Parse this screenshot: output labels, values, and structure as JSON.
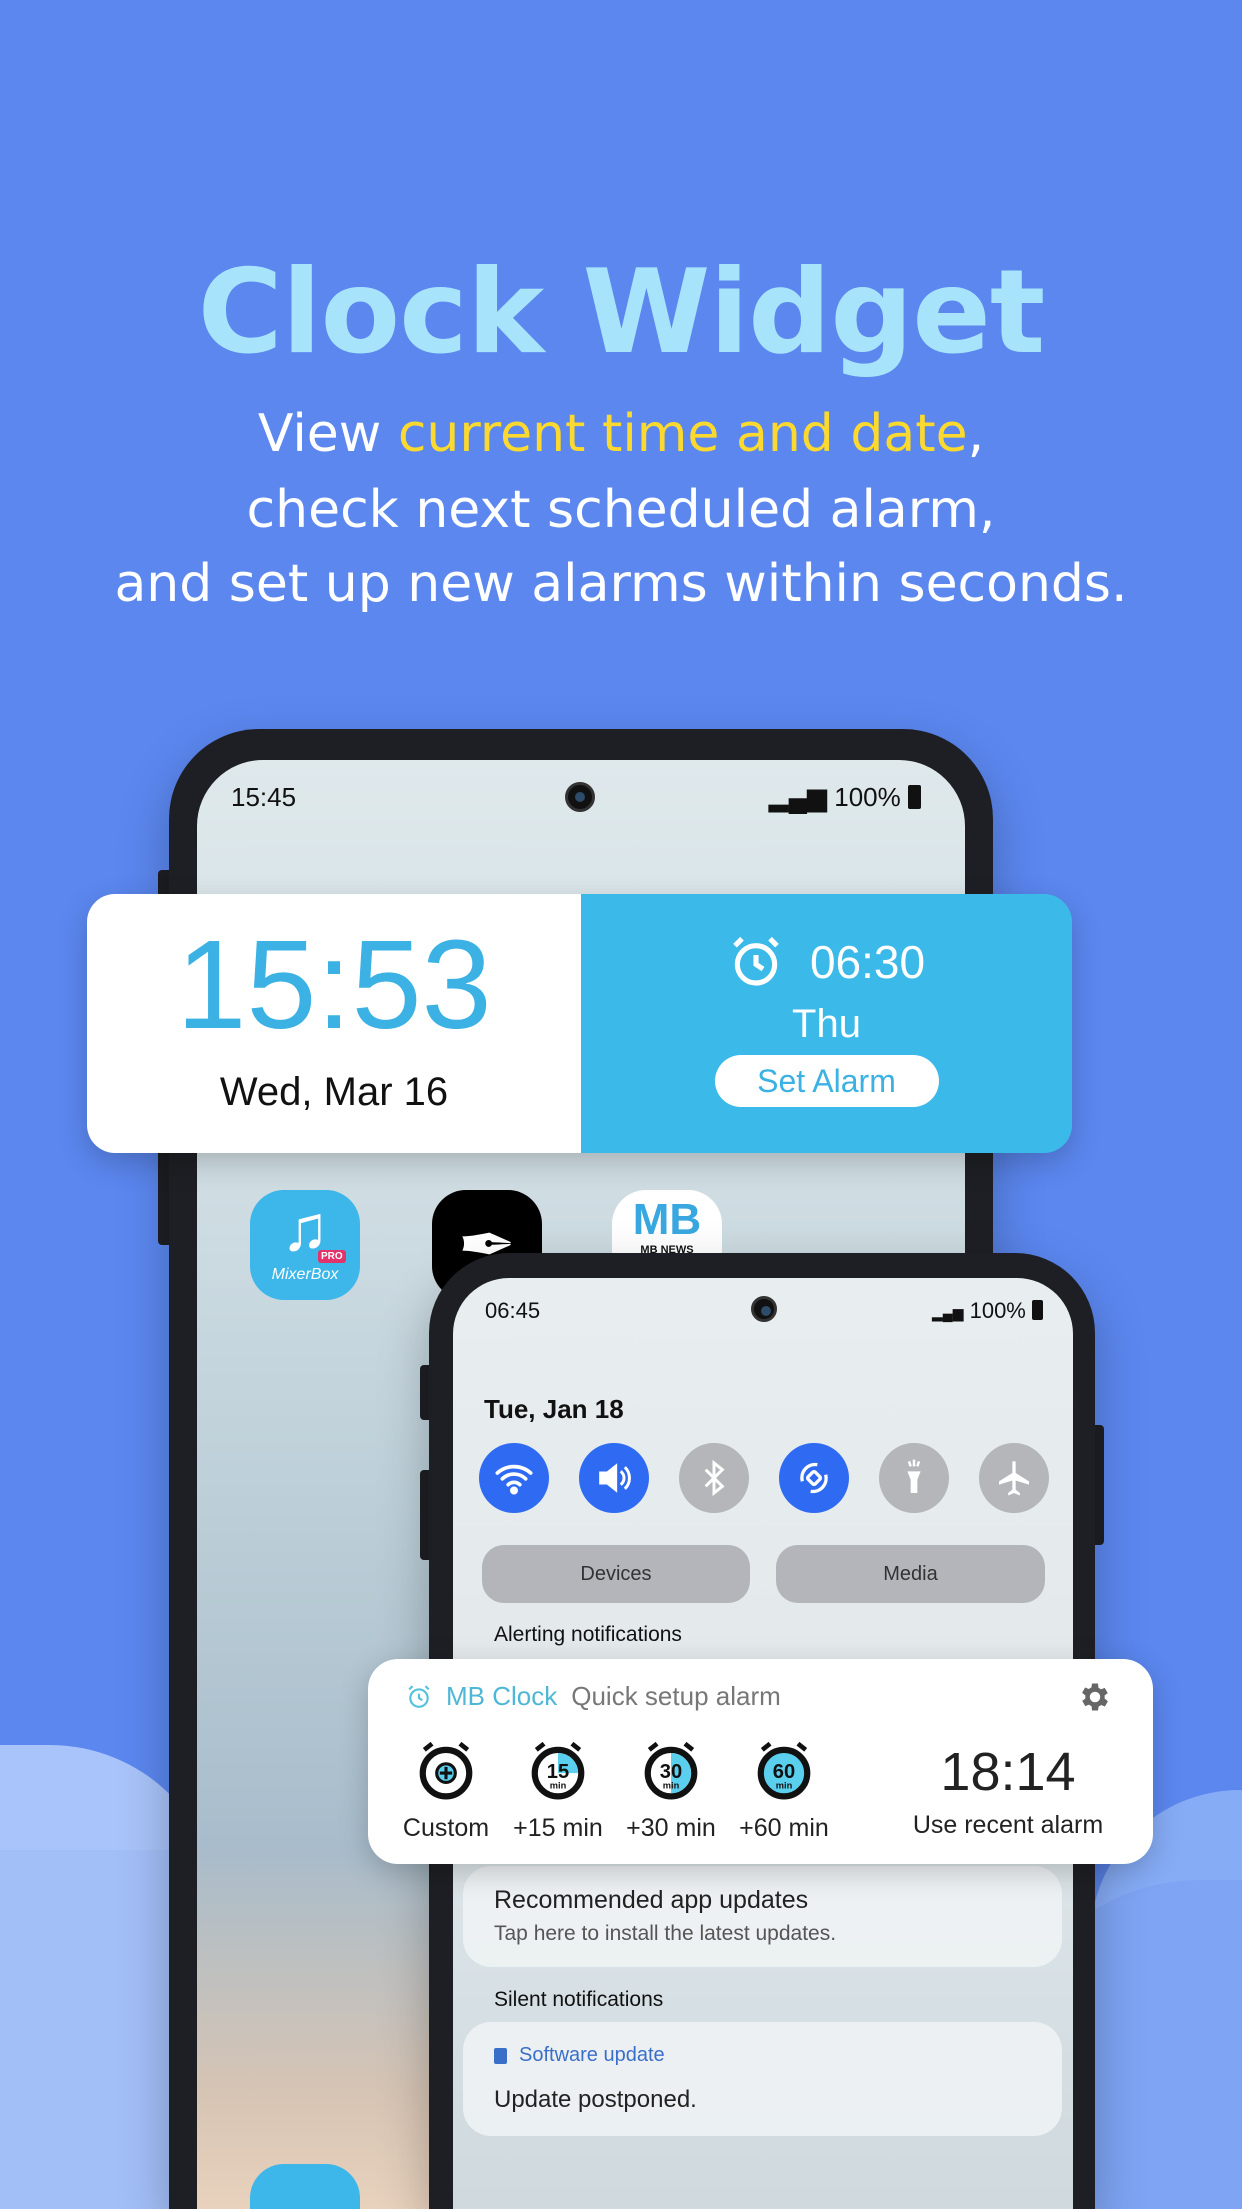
{
  "headline": {
    "title": "Clock Widget",
    "line1_pre": "View ",
    "line1_highlight": "current time and date",
    "line1_post": ",",
    "line2": "check next scheduled alarm,",
    "line3": "and set up new alarms within seconds."
  },
  "colors": {
    "background": "#5b87ef",
    "title": "#a7e4fb",
    "highlight": "#fbd92e",
    "widget_accent": "#3bb9e9",
    "toggle_on": "#2f6af2"
  },
  "phone1": {
    "status_time": "15:45",
    "battery": "100%",
    "widget": {
      "time": "15:53",
      "date": "Wed, Mar 16",
      "alarm_time": "06:30",
      "alarm_day": "Thu",
      "set_alarm_label": "Set Alarm"
    },
    "apps": [
      {
        "name": "MixerBox",
        "badge": "PRO"
      },
      {
        "name": "quill"
      },
      {
        "name": "MB NEWS",
        "text": "MB"
      }
    ]
  },
  "phone2": {
    "status_time": "06:45",
    "battery": "100%",
    "date": "Tue, Jan 18",
    "toggles": [
      {
        "icon": "wifi-icon",
        "on": true
      },
      {
        "icon": "volume-icon",
        "on": true
      },
      {
        "icon": "bluetooth-icon",
        "on": false
      },
      {
        "icon": "auto-rotate-icon",
        "on": true
      },
      {
        "icon": "flashlight-icon",
        "on": false
      },
      {
        "icon": "airplane-icon",
        "on": false
      }
    ],
    "devices_label": "Devices",
    "media_label": "Media",
    "alerting_header": "Alerting notifications",
    "quick_alarm": {
      "app_name": "MB Clock",
      "subtitle": "Quick setup alarm",
      "actions": [
        {
          "label": "Custom",
          "icon": "plus"
        },
        {
          "label": "+15 min",
          "num": "15",
          "unit": "min"
        },
        {
          "label": "+30 min",
          "num": "30",
          "unit": "min"
        },
        {
          "label": "+60 min",
          "num": "60",
          "unit": "min"
        }
      ],
      "recent_time": "18:14",
      "recent_label": "Use recent alarm"
    },
    "recommended": {
      "title": "Recommended app updates",
      "body": "Tap here to install the latest updates."
    },
    "silent_header": "Silent notifications",
    "software_update": {
      "app": "Software update",
      "body": "Update postponed."
    }
  }
}
